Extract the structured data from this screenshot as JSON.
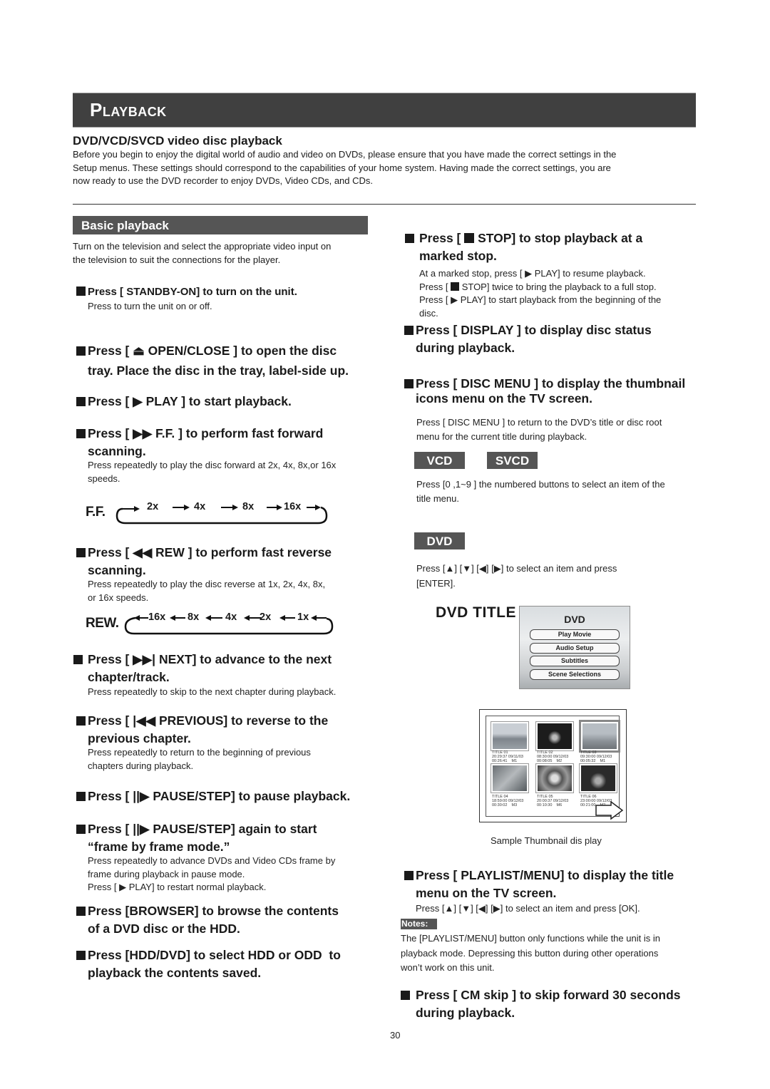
{
  "header": {
    "title": "Playback"
  },
  "intro": {
    "heading": "DVD/VCD/SVCD video disc playback",
    "lines": [
      "Before you begin to enjoy the digital world of audio and video on DVDs, please ensure that you have made the correct settings in the",
      "Setup menus. These settings should correspond to the capabilities of your home system. Having made the correct settings, you are",
      "now ready to use the DVD recorder to enjoy DVDs, Video CDs, and CDs."
    ]
  },
  "left": {
    "section_title": "Basic playback",
    "section_lines": [
      "Turn on the television and select the appropriate video input on",
      "the television to suit the connections for the player."
    ],
    "standby": {
      "heading": "Press [ STANDBY-ON] to turn on the unit.",
      "desc": "Press to turn the unit on or off."
    },
    "open_close": {
      "pre": "Press [ ",
      "key": "OPEN/CLOSE ] to open the disc",
      "line2": "tray. Place the disc in the tray, label-side up."
    },
    "play": {
      "pre": "Press [ ",
      "key": "PLAY ] to start playback."
    },
    "ff": {
      "pre": "Press [ ",
      "key": "F.F. ] to perform fast forward",
      "line2": "scanning.",
      "desc1": "Press repeatedly to play the disc forward at 2x, 4x, 8x,or 16x",
      "desc2": "speeds.",
      "diagram_label": "F.F.",
      "speeds": [
        "2x",
        "4x",
        "8x",
        "16x"
      ]
    },
    "rew": {
      "pre": "Press [ ",
      "key": "REW ] to perform fast reverse",
      "line2": "scanning.",
      "desc1": "Press repeatedly to play the disc reverse at 1x, 2x, 4x, 8x,",
      "desc2": "or 16x speeds.",
      "diagram_label": "REW.",
      "speeds": [
        "16x",
        "8x",
        "4x",
        "2x",
        "1x"
      ]
    },
    "next": {
      "pre": "Press [ ",
      "key": "NEXT] to advance to the next",
      "line2": "chapter/track.",
      "desc": "Press repeatedly to skip to the next chapter during playback."
    },
    "previous": {
      "pre": "Press [ ",
      "key": "PREVIOUS] to reverse to the",
      "line2": "previous chapter.",
      "desc1": "Press repeatedly to return to the beginning of previous",
      "desc2": "chapters during playback."
    },
    "pause": {
      "pre": "Press [ ",
      "key": "PAUSE/STEP] to pause playback."
    },
    "step": {
      "pre": "Press [ ",
      "key": "PAUSE/STEP] again to start",
      "line2": "“frame by frame mode.”",
      "desc1": "Press repeatedly to advance DVDs and Video CDs frame by",
      "desc2": "frame during playback in pause mode.",
      "desc3_pre": "Press [ ",
      "desc3_post": " PLAY] to restart normal playback."
    },
    "browser": {
      "line1": "Press [BROWSER] to browse the contents",
      "line2": "of a DVD disc or the HDD."
    },
    "hdd_dvd": {
      "line1": "Press [HDD/DVD] to select HDD or ODD  to",
      "line2": "playback the contents saved."
    }
  },
  "right": {
    "stop": {
      "pre": "Press [ ",
      "key": " STOP] to stop playback at a",
      "line2": "marked stop.",
      "d1_pre": "At a marked stop, press [ ",
      "d1_post": " PLAY] to resume playback.",
      "d2_pre": "Press [ ",
      "d2_post": " STOP] twice to bring the playback to a full stop.",
      "d3_pre": "Press [ ",
      "d3_post": " PLAY] to start playback from the beginning of the",
      "d4": "disc."
    },
    "display": {
      "line1": "Press [ DISPLAY ] to display disc status",
      "line2": "during playback."
    },
    "disc_menu": {
      "line1": "Press [ DISC MENU ] to display the thumbnail",
      "line2": "icons menu on the TV screen.",
      "desc1": "Press [ DISC MENU ] to return to the DVD’s title or disc root",
      "desc2": "menu for the current title during playback."
    },
    "tags": {
      "vcd": "VCD",
      "svcd": "SVCD",
      "dvd": "DVD"
    },
    "vcd_desc1": "Press [0 ,1~9 ] the numbered buttons to select an item of the",
    "vcd_desc2": "title menu.",
    "dvd_desc1_pre": "Press [",
    "dvd_desc1_post": "] to select an item and press",
    "dvd_desc2": "[ENTER].",
    "dvd_menu": {
      "label": "DVD TITLE",
      "screen_title": "DVD",
      "buttons": [
        "Play Movie",
        "Audio Setup",
        "Subtitles",
        "Scene Selections"
      ]
    },
    "thumbnails": {
      "items": [
        {
          "title": "TITLE 01",
          "datetime": "20:29:37 09/11/03",
          "info": "00:26:41    M1"
        },
        {
          "title": "TITLE 02",
          "datetime": "08:30:00 09/12/03",
          "info": "00:08:05    M2"
        },
        {
          "title": "TITLE 03",
          "datetime": "09:30:00 09/12/03",
          "info": "00:05:32    M1"
        },
        {
          "title": "TITLE 04",
          "datetime": "18:59:00 09/12/03",
          "info": "00:30:02    M3"
        },
        {
          "title": "TITLE 05",
          "datetime": "20:00:37 09/12/03",
          "info": "00:10:30    M6"
        },
        {
          "title": "TITLE 06",
          "datetime": "23:00:00 09/12/03",
          "info": "00:21:00    M2"
        }
      ],
      "caption": "Sample Thumbnail dis play"
    },
    "playlist": {
      "line1": "Press [ PLAYLIST/MENU] to display the title",
      "line2": "menu on the TV screen.",
      "desc_pre": "Press [",
      "desc_post": "] to select an item and press [OK]."
    },
    "notes": {
      "label": "Notes:",
      "lines": [
        "The [PLAYLIST/MENU] button only functions while the unit is in",
        "playback mode. Depressing this button during other operations",
        "won’t work on this unit."
      ]
    },
    "cm_skip": {
      "line1": "Press [ CM skip ] to skip forward 30 seconds",
      "line2": "during playback."
    }
  },
  "footer": {
    "page_number": "30"
  }
}
